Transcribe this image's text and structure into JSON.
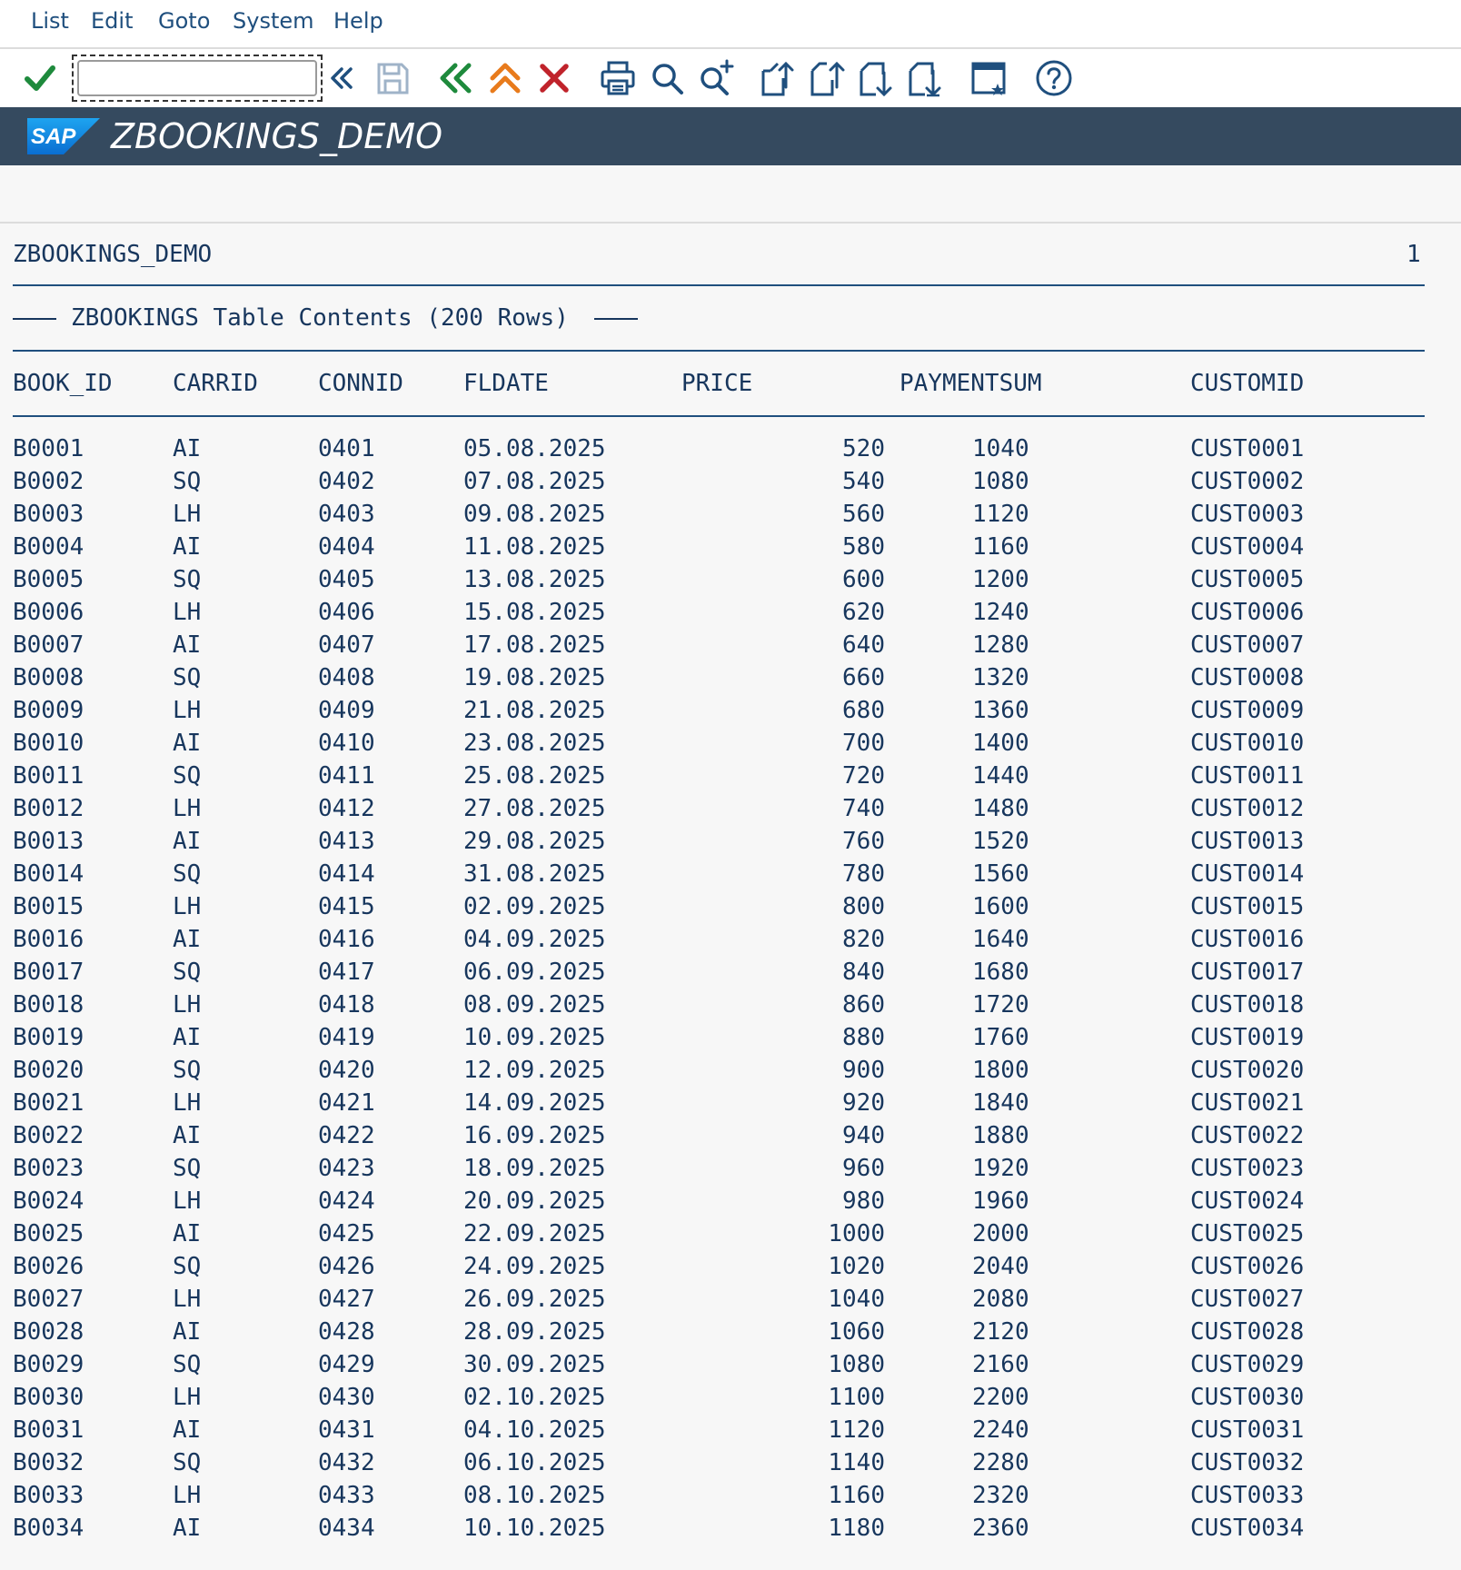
{
  "menu": {
    "items": [
      "List",
      "Edit",
      "Goto",
      "System",
      "Help"
    ]
  },
  "toolbar": {
    "command_value": "",
    "icons": [
      "check-icon",
      "expand-icon",
      "save-icon",
      "back-icon",
      "exit-icon",
      "cancel-icon",
      "print-icon",
      "find-icon",
      "find-next-icon",
      "first-page-icon",
      "previous-page-icon",
      "next-page-icon",
      "last-page-icon",
      "customize-layout-icon",
      "help-icon"
    ]
  },
  "title_bar": {
    "logo_text": "SAP",
    "title": "ZBOOKINGS_DEMO"
  },
  "list": {
    "report_name": "ZBOOKINGS_DEMO",
    "page_number": "1",
    "caption": "ZBOOKINGS Table Contents (200 Rows)",
    "columns": [
      "BOOK_ID",
      "CARRID",
      "CONNID",
      "FLDATE",
      "PRICE",
      "PAYMENTSUM",
      "CUSTOMID"
    ],
    "rows": [
      [
        "B0001",
        "AI",
        "0401",
        "05.08.2025",
        "520",
        "1040",
        "CUST0001"
      ],
      [
        "B0002",
        "SQ",
        "0402",
        "07.08.2025",
        "540",
        "1080",
        "CUST0002"
      ],
      [
        "B0003",
        "LH",
        "0403",
        "09.08.2025",
        "560",
        "1120",
        "CUST0003"
      ],
      [
        "B0004",
        "AI",
        "0404",
        "11.08.2025",
        "580",
        "1160",
        "CUST0004"
      ],
      [
        "B0005",
        "SQ",
        "0405",
        "13.08.2025",
        "600",
        "1200",
        "CUST0005"
      ],
      [
        "B0006",
        "LH",
        "0406",
        "15.08.2025",
        "620",
        "1240",
        "CUST0006"
      ],
      [
        "B0007",
        "AI",
        "0407",
        "17.08.2025",
        "640",
        "1280",
        "CUST0007"
      ],
      [
        "B0008",
        "SQ",
        "0408",
        "19.08.2025",
        "660",
        "1320",
        "CUST0008"
      ],
      [
        "B0009",
        "LH",
        "0409",
        "21.08.2025",
        "680",
        "1360",
        "CUST0009"
      ],
      [
        "B0010",
        "AI",
        "0410",
        "23.08.2025",
        "700",
        "1400",
        "CUST0010"
      ],
      [
        "B0011",
        "SQ",
        "0411",
        "25.08.2025",
        "720",
        "1440",
        "CUST0011"
      ],
      [
        "B0012",
        "LH",
        "0412",
        "27.08.2025",
        "740",
        "1480",
        "CUST0012"
      ],
      [
        "B0013",
        "AI",
        "0413",
        "29.08.2025",
        "760",
        "1520",
        "CUST0013"
      ],
      [
        "B0014",
        "SQ",
        "0414",
        "31.08.2025",
        "780",
        "1560",
        "CUST0014"
      ],
      [
        "B0015",
        "LH",
        "0415",
        "02.09.2025",
        "800",
        "1600",
        "CUST0015"
      ],
      [
        "B0016",
        "AI",
        "0416",
        "04.09.2025",
        "820",
        "1640",
        "CUST0016"
      ],
      [
        "B0017",
        "SQ",
        "0417",
        "06.09.2025",
        "840",
        "1680",
        "CUST0017"
      ],
      [
        "B0018",
        "LH",
        "0418",
        "08.09.2025",
        "860",
        "1720",
        "CUST0018"
      ],
      [
        "B0019",
        "AI",
        "0419",
        "10.09.2025",
        "880",
        "1760",
        "CUST0019"
      ],
      [
        "B0020",
        "SQ",
        "0420",
        "12.09.2025",
        "900",
        "1800",
        "CUST0020"
      ],
      [
        "B0021",
        "LH",
        "0421",
        "14.09.2025",
        "920",
        "1840",
        "CUST0021"
      ],
      [
        "B0022",
        "AI",
        "0422",
        "16.09.2025",
        "940",
        "1880",
        "CUST0022"
      ],
      [
        "B0023",
        "SQ",
        "0423",
        "18.09.2025",
        "960",
        "1920",
        "CUST0023"
      ],
      [
        "B0024",
        "LH",
        "0424",
        "20.09.2025",
        "980",
        "1960",
        "CUST0024"
      ],
      [
        "B0025",
        "AI",
        "0425",
        "22.09.2025",
        "1000",
        "2000",
        "CUST0025"
      ],
      [
        "B0026",
        "SQ",
        "0426",
        "24.09.2025",
        "1020",
        "2040",
        "CUST0026"
      ],
      [
        "B0027",
        "LH",
        "0427",
        "26.09.2025",
        "1040",
        "2080",
        "CUST0027"
      ],
      [
        "B0028",
        "AI",
        "0428",
        "28.09.2025",
        "1060",
        "2120",
        "CUST0028"
      ],
      [
        "B0029",
        "SQ",
        "0429",
        "30.09.2025",
        "1080",
        "2160",
        "CUST0029"
      ],
      [
        "B0030",
        "LH",
        "0430",
        "02.10.2025",
        "1100",
        "2200",
        "CUST0030"
      ],
      [
        "B0031",
        "AI",
        "0431",
        "04.10.2025",
        "1120",
        "2240",
        "CUST0031"
      ],
      [
        "B0032",
        "SQ",
        "0432",
        "06.10.2025",
        "1140",
        "2280",
        "CUST0032"
      ],
      [
        "B0033",
        "LH",
        "0433",
        "08.10.2025",
        "1160",
        "2320",
        "CUST0033"
      ],
      [
        "B0034",
        "AI",
        "0434",
        "10.10.2025",
        "1180",
        "2360",
        "CUST0034"
      ]
    ]
  },
  "colors": {
    "menu_text": "#1f4f7e",
    "title_bar_bg": "#354a5f",
    "list_text": "#17365d",
    "rule": "#1f4f7e",
    "check_green": "#1e8a3c",
    "cancel_red": "#c0232b",
    "exit_orange": "#e87b1c"
  }
}
